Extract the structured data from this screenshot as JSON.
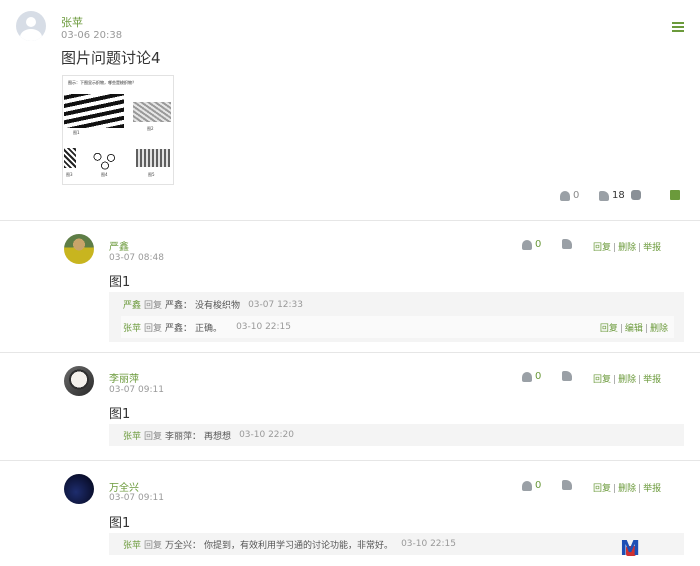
{
  "post": {
    "author": "张苹",
    "time": "03-06 20:38",
    "title": "图片问题讨论4",
    "image_caption": "图示：下图显示织物，哪些是梭织物？",
    "image_labels": [
      "图1",
      "图2",
      "图3",
      "图4",
      "图5"
    ],
    "flower_count": "0",
    "like_count": "18"
  },
  "comments": [
    {
      "author": "严鑫",
      "time": "03-07 08:48",
      "body": "图1",
      "flower_count": "0",
      "actions": [
        "回复",
        "删除",
        "举报"
      ],
      "replies": [
        {
          "name": "严鑫",
          "word": "回复",
          "target": "严鑫：",
          "text": "没有梭织物",
          "time": "03-07 12:33"
        },
        {
          "name": "张苹",
          "word": "回复",
          "target": "严鑫：",
          "text": "正确。",
          "time": "03-10 22:15",
          "actions": [
            "回复",
            "编辑",
            "删除"
          ]
        }
      ]
    },
    {
      "author": "李丽萍",
      "time": "03-07 09:11",
      "body": "图1",
      "flower_count": "0",
      "actions": [
        "回复",
        "删除",
        "举报"
      ],
      "replies": [
        {
          "name": "张苹",
          "word": "回复",
          "target": "李丽萍：",
          "text": "再想想",
          "time": "03-10 22:20"
        }
      ]
    },
    {
      "author": "万全兴",
      "time": "03-07 09:11",
      "body": "图1",
      "flower_count": "0",
      "actions": [
        "回复",
        "删除",
        "举报"
      ],
      "replies": [
        {
          "name": "张苹",
          "word": "回复",
          "target": "万全兴：",
          "text": "你提到，有效利用学习通的讨论功能，非常好。",
          "time": "03-10 22:15"
        }
      ]
    }
  ]
}
